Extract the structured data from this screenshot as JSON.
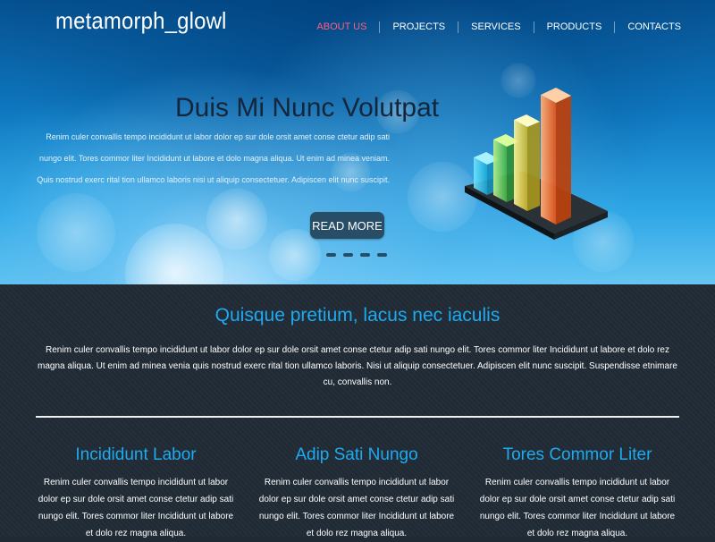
{
  "brand": {
    "logo": "metamorph_glowl",
    "accent_color": "#ff5f7d",
    "title_color": "#1faaf0"
  },
  "nav": {
    "items": [
      {
        "label": "ABOUT US",
        "active": true
      },
      {
        "label": "PROJECTS",
        "active": false
      },
      {
        "label": "SERVICES",
        "active": false
      },
      {
        "label": "PRODUCTS",
        "active": false
      },
      {
        "label": "CONTACTS",
        "active": false
      }
    ]
  },
  "hero": {
    "title": "Duis Mi Nunc Volutpat",
    "lines": [
      "Renim culer convallis tempo incididunt ut labor dolor ep sur dole orsit amet conse ctetur adip sati",
      "nungo elit. Tores commor liter Incididunt ut labore et dolo magna aliqua. Ut enim ad minea veniam.",
      "Quis nostrud exerc rital tion ullamco laboris nisi ut aliquip consectetuer. Adipiscen elit nunc suscipit."
    ],
    "button_label": "READ MORE",
    "slide_count": 4,
    "graphic": "bar-chart-illustration-icon"
  },
  "intro": {
    "title": "Quisque pretium, lacus nec iaculis",
    "text": "Renim culer convallis tempo incididunt ut labor dolor ep sur dole orsit amet conse ctetur adip sati nungo elit. Tores commor liter Incididunt ut labore et dolo rez magna aliqua. Ut enim ad minea venia quis nostrud exerc rital tion ullamco laboris. Nisi ut aliquip consectetuer. Adipiscen elit nunc suscipit. Suspendisse etnimare cu, convallis non."
  },
  "columns": [
    {
      "title": "Incididunt Labor",
      "text": "Renim culer convallis tempo incididunt ut labor dolor ep sur dole orsit amet conse ctetur adip sati nungo elit. Tores commor liter Incididunt ut labore et dolo rez magna aliqua."
    },
    {
      "title": "Adip Sati Nungo",
      "text": "Renim culer convallis tempo incididunt ut labor dolor ep sur dole orsit amet conse ctetur adip sati nungo elit. Tores commor liter Incididunt ut labore et dolo rez magna aliqua."
    },
    {
      "title": "Tores Commor Liter",
      "text": "Renim culer convallis tempo incididunt ut labor dolor ep sur dole orsit amet conse ctetur adip sati nungo elit. Tores commor liter Incididunt ut labore et dolo rez magna aliqua."
    }
  ]
}
